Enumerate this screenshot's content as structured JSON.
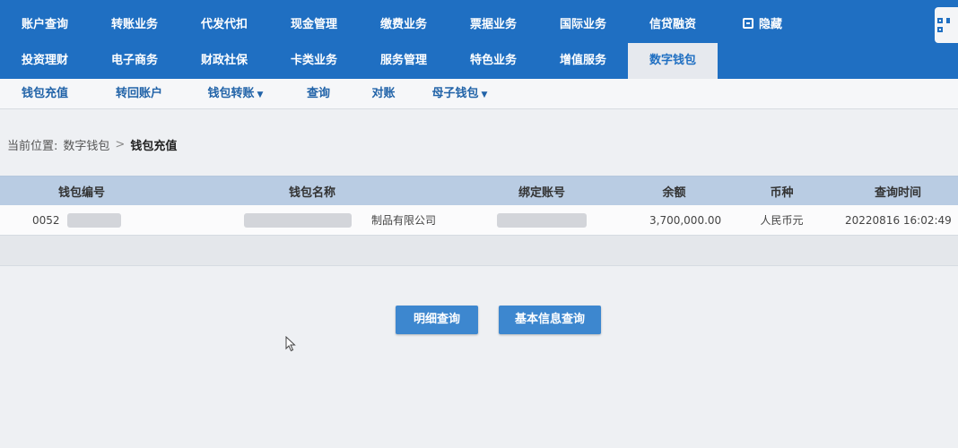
{
  "topnav": {
    "row1": [
      "账户查询",
      "转账业务",
      "代发代扣",
      "现金管理",
      "缴费业务",
      "票据业务",
      "国际业务",
      "信贷融资"
    ],
    "hide_label": "隐藏",
    "row2": [
      "投资理财",
      "电子商务",
      "财政社保",
      "卡类业务",
      "服务管理",
      "特色业务",
      "增值服务",
      "数字钱包"
    ],
    "active": "数字钱包"
  },
  "subnav": [
    "钱包充值",
    "转回账户",
    "钱包转账",
    "查询",
    "对账",
    "母子钱包"
  ],
  "breadcrumb": {
    "prefix": "当前位置:",
    "parent": "数字钱包",
    "current": "钱包充值"
  },
  "table": {
    "headers": [
      "钱包编号",
      "钱包名称",
      "绑定账号",
      "余额",
      "币种",
      "查询时间"
    ],
    "rows": [
      {
        "wallet_no": "0052",
        "wallet_name": "制品有限公司",
        "account": "",
        "balance": "3,700,000.00",
        "currency": "人民币元",
        "query_time": "20220816 16:02:49"
      }
    ]
  },
  "buttons": {
    "detail": "明细查询",
    "basic_info": "基本信息查询"
  },
  "colors": {
    "nav_blue": "#1f6fc2",
    "header_bg": "#b9cce3",
    "button_blue": "#3d87cf"
  }
}
